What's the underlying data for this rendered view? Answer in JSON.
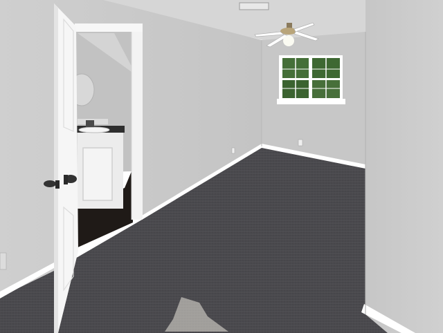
{
  "image": {
    "subject": "empty-carpeted-bedroom",
    "colors": {
      "wall": "#c9c9c9",
      "wall_shadow": "#b8b8b8",
      "ceiling": "#d6d6d6",
      "carpet": "#4b4a4d",
      "trim": "#ffffff",
      "door": "#f6f6f6",
      "bath_wall": "#c3c3c3",
      "vanity_top": "#2e2e2e",
      "bath_floor": "#1e1a18",
      "window_glass": "#3f6a34",
      "door_hardware": "#333333"
    }
  }
}
